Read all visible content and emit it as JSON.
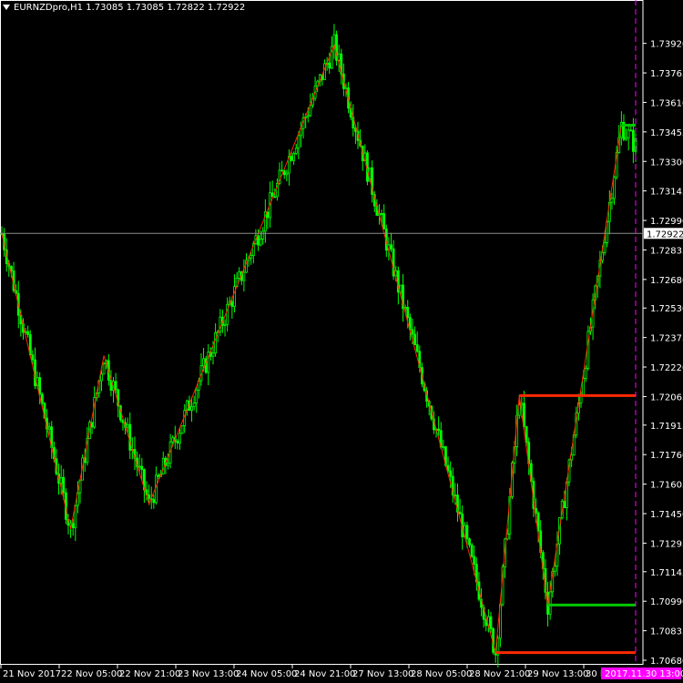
{
  "header": {
    "symbol": "EURNZDpro,H1",
    "open": "1.73085",
    "high": "1.73085",
    "low": "1.72822",
    "close": "1.72922"
  },
  "colors": {
    "background": "#000000",
    "axis": "#ffffff",
    "bull_candle": "#00ff00",
    "zigzag": "#ff2a00",
    "level_support": "#ff2a00",
    "level_green": "#00c800",
    "current_price_line": "#8c8c8c",
    "time_marker": "#ff00ff"
  },
  "chart_data": {
    "type": "candlestick",
    "instrument": "EURNZDpro",
    "timeframe": "H1",
    "ylim": [
      1.7068,
      1.7399
    ],
    "y_ticks": [
      "1.73920",
      "1.73765",
      "1.73610",
      "1.73455",
      "1.73300",
      "1.73145",
      "1.72990",
      "1.72835",
      "1.72680",
      "1.72530",
      "1.72375",
      "1.72220",
      "1.72065",
      "1.71915",
      "1.71760",
      "1.71605",
      "1.71450",
      "1.71295",
      "1.71145",
      "1.70990",
      "1.70835",
      "1.70680"
    ],
    "x_ticks": [
      "21 Nov 2017",
      "22 Nov 05:00",
      "22 Nov 21:00",
      "23 Nov 13:00",
      "24 Nov 05:00",
      "24 Nov 21:00",
      "27 Nov 13:00",
      "28 Nov 05:00",
      "28 Nov 21:00",
      "29 Nov 13:00",
      "30 N"
    ],
    "current_price": "1.72922",
    "current_time_label": "2017.11.30 13:00",
    "zigzag_points": [
      {
        "bar": 0,
        "price": 1.7292
      },
      {
        "bar": 29,
        "price": 1.7137
      },
      {
        "bar": 43,
        "price": 1.7228
      },
      {
        "bar": 62,
        "price": 1.715
      },
      {
        "bar": 140,
        "price": 1.7391
      },
      {
        "bar": 208,
        "price": 1.7072
      },
      {
        "bar": 218,
        "price": 1.7207
      },
      {
        "bar": 230,
        "price": 1.7097
      },
      {
        "bar": 261,
        "price": 1.7349
      }
    ],
    "levels": [
      {
        "price": 1.7207,
        "from_bar": 218,
        "color": "red"
      },
      {
        "price": 1.7349,
        "from_bar": 261,
        "color": "green"
      },
      {
        "price": 1.7097,
        "from_bar": 230,
        "color": "green"
      },
      {
        "price": 1.7072,
        "from_bar": 208,
        "color": "red"
      }
    ],
    "bar_count": 268
  }
}
